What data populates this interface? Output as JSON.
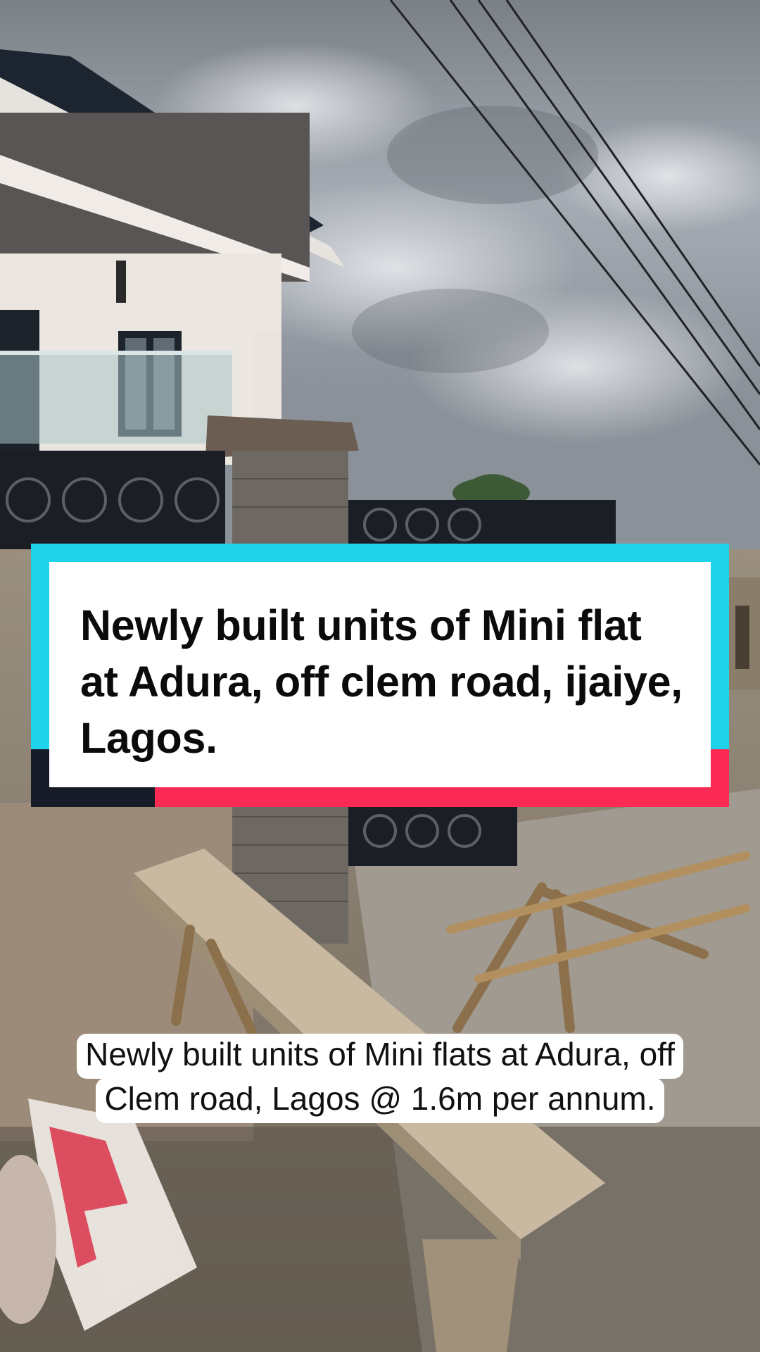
{
  "title_card": {
    "text": "Newly built units of Mini flat at Adura, off clem road, ijaiye, Lagos."
  },
  "caption": {
    "text": "Newly built units of Mini flats at Adura, off Clem road, Lagos @ 1.6m per annum."
  },
  "colors": {
    "card_cyan": "#20d3ea",
    "card_red": "#fa2a55",
    "card_dark": "#171b27",
    "card_inner": "#ffffff"
  },
  "background_icons": [
    "cloudy-sky",
    "house",
    "power-lines",
    "palm-tree",
    "fence-gate",
    "wooden-plank",
    "cement-bag"
  ]
}
